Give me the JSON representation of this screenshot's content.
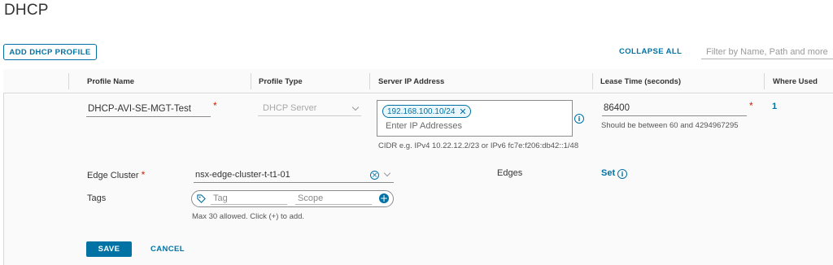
{
  "page": {
    "title": "DHCP"
  },
  "toolbar": {
    "add_label": "ADD DHCP PROFILE",
    "collapse_label": "COLLAPSE ALL",
    "filter_placeholder": "Filter by Name, Path and more"
  },
  "table": {
    "columns": [
      "Profile Name",
      "Profile Type",
      "Server IP Address",
      "Lease Time (seconds)",
      "Where Used"
    ]
  },
  "form": {
    "profile_name": "DHCP-AVI-SE-MGT-Test",
    "profile_type": "DHCP Server",
    "server_ip_chip": "192.168.100.10/24",
    "server_ip_placeholder": "Enter IP Addresses",
    "server_ip_help": "CIDR e.g. IPv4 10.22.12.2/23 or IPv6 fc7e:f206:db42::1/48",
    "lease_time": "86400",
    "lease_help": "Should be between 60 and 4294967295",
    "where_used": "1",
    "required_mark": "*",
    "edge_cluster_label": "Edge Cluster",
    "edge_cluster_value": "nsx-edge-cluster-t-t1-01",
    "edges_label": "Edges",
    "edges_link": "Set",
    "tags_label": "Tags",
    "tag_placeholder": "Tag",
    "scope_placeholder": "Scope",
    "tags_help": "Max 30 allowed. Click (+) to add.",
    "save_label": "SAVE",
    "cancel_label": "CANCEL"
  },
  "icons": {
    "info": "info-icon",
    "clear": "clear-icon",
    "tag": "tag-icon",
    "add": "plus-icon",
    "chevron": "chevron-down-icon"
  },
  "colors": {
    "accent": "#0072a3",
    "required": "#c92100"
  }
}
